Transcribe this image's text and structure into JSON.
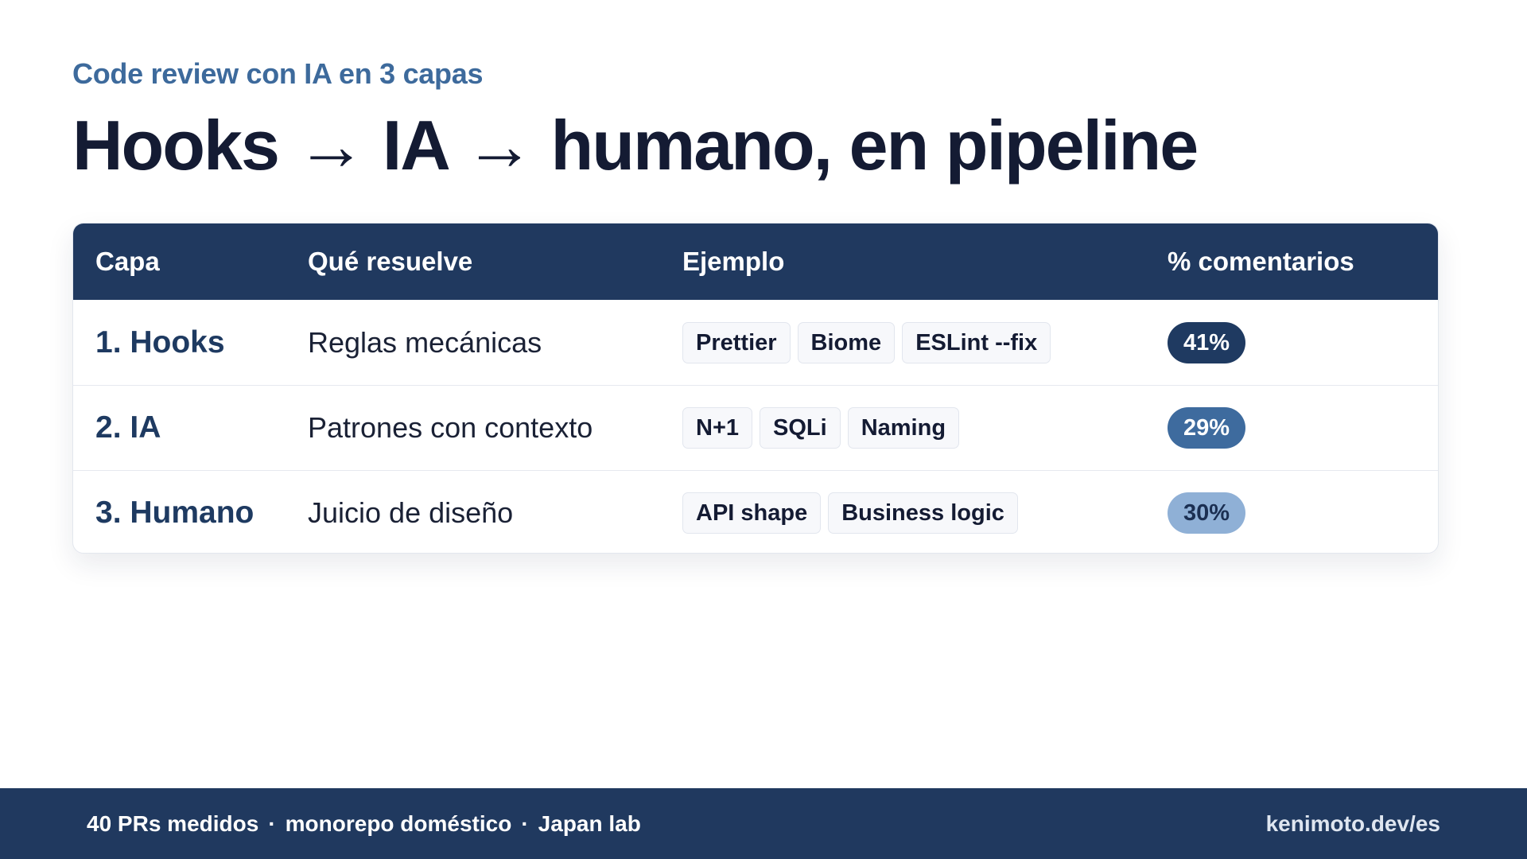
{
  "header": {
    "kicker": "Code review con IA en 3 capas",
    "title": "Hooks → IA → humano, en pipeline"
  },
  "table": {
    "columns": [
      "Capa",
      "Qué resuelve",
      "Ejemplo",
      "% comentarios"
    ],
    "rows": [
      {
        "layer": "1. Hooks",
        "resolves": "Reglas mecánicas",
        "examples": [
          "Prettier",
          "Biome",
          "ESLint --fix"
        ],
        "percent": "41%",
        "pill_bg": "#1f3a61",
        "pill_fg": "#ffffff"
      },
      {
        "layer": "2. IA",
        "resolves": "Patrones con contexto",
        "examples": [
          "N+1",
          "SQLi",
          "Naming"
        ],
        "percent": "29%",
        "pill_bg": "#3e6b9e",
        "pill_fg": "#ffffff"
      },
      {
        "layer": "3. Humano",
        "resolves": "Juicio de diseño",
        "examples": [
          "API shape",
          "Business logic"
        ],
        "percent": "30%",
        "pill_bg": "#8fb0d6",
        "pill_fg": "#1b2f52"
      }
    ]
  },
  "footer": {
    "items": [
      "40 PRs medidos",
      "monorepo doméstico",
      "Japan lab"
    ],
    "separator": "·",
    "url": "kenimoto.dev/es"
  },
  "colors": {
    "navy": "#20395f",
    "accent": "#3d6a9c",
    "text": "#141b33"
  }
}
